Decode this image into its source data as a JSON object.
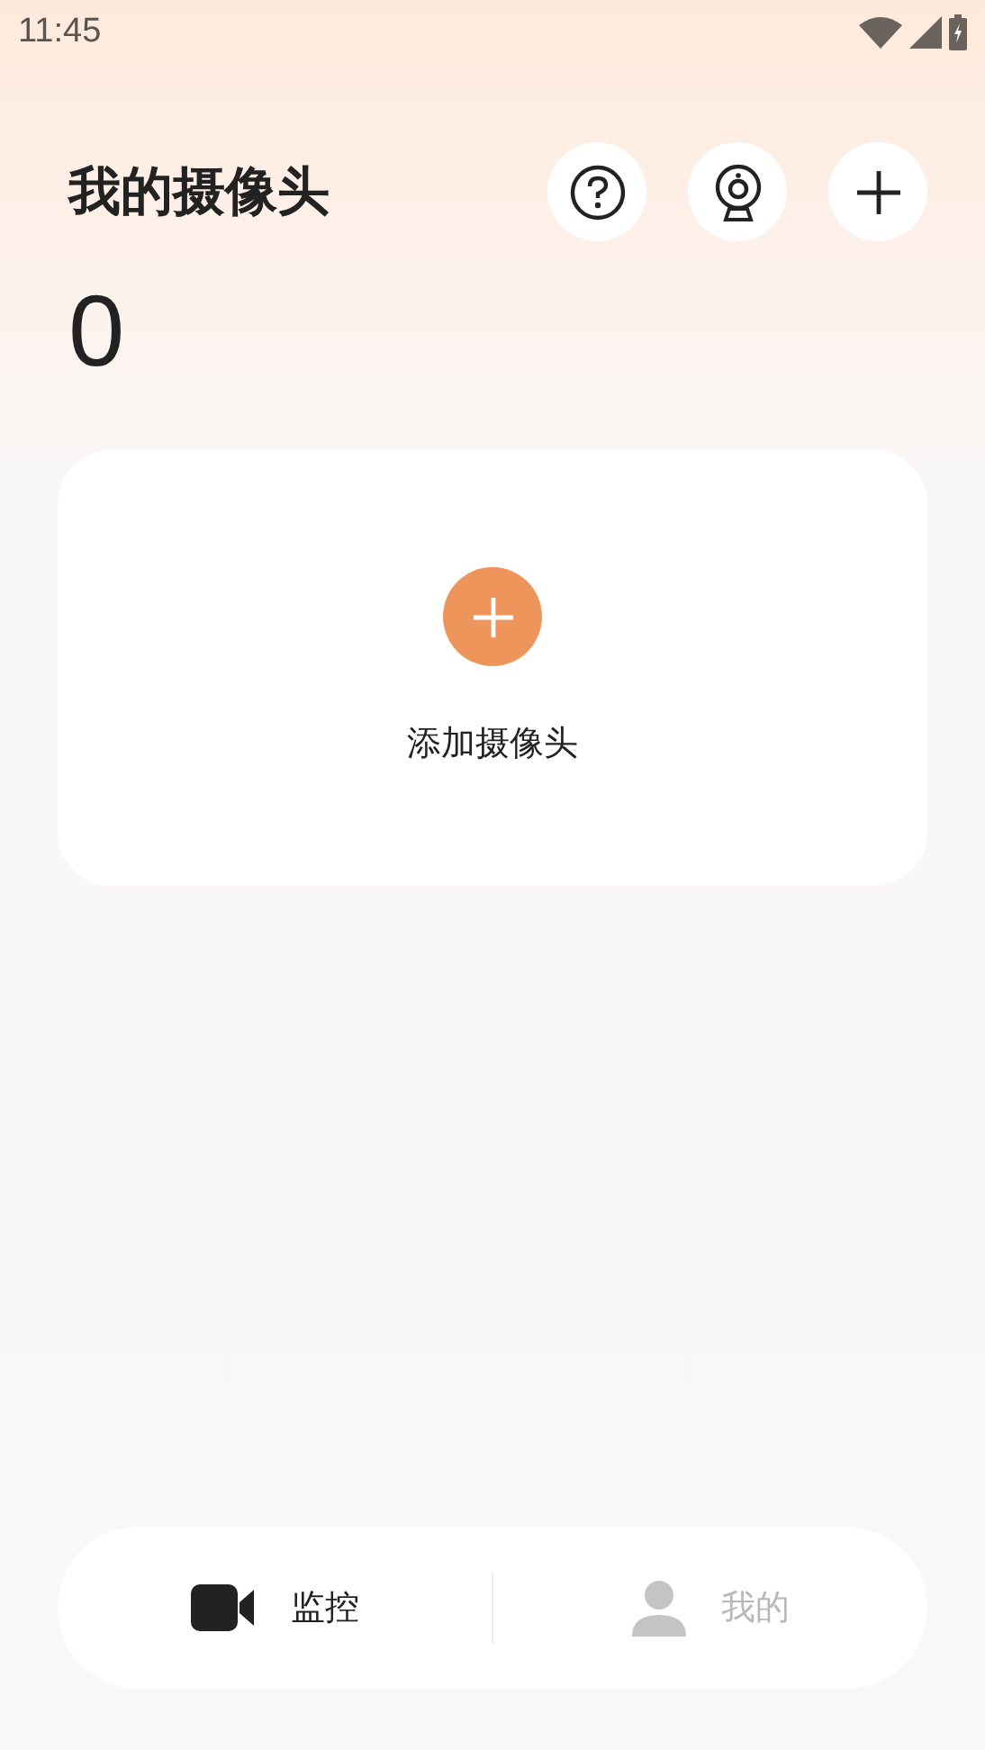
{
  "status_bar": {
    "time": "11:45"
  },
  "header": {
    "title": "我的摄像头",
    "count": "0"
  },
  "add_card": {
    "label": "添加摄像头"
  },
  "tabs": [
    {
      "label": "监控",
      "kind": "camera",
      "selected": true
    },
    {
      "label": "我的",
      "kind": "person",
      "selected": false
    }
  ]
}
